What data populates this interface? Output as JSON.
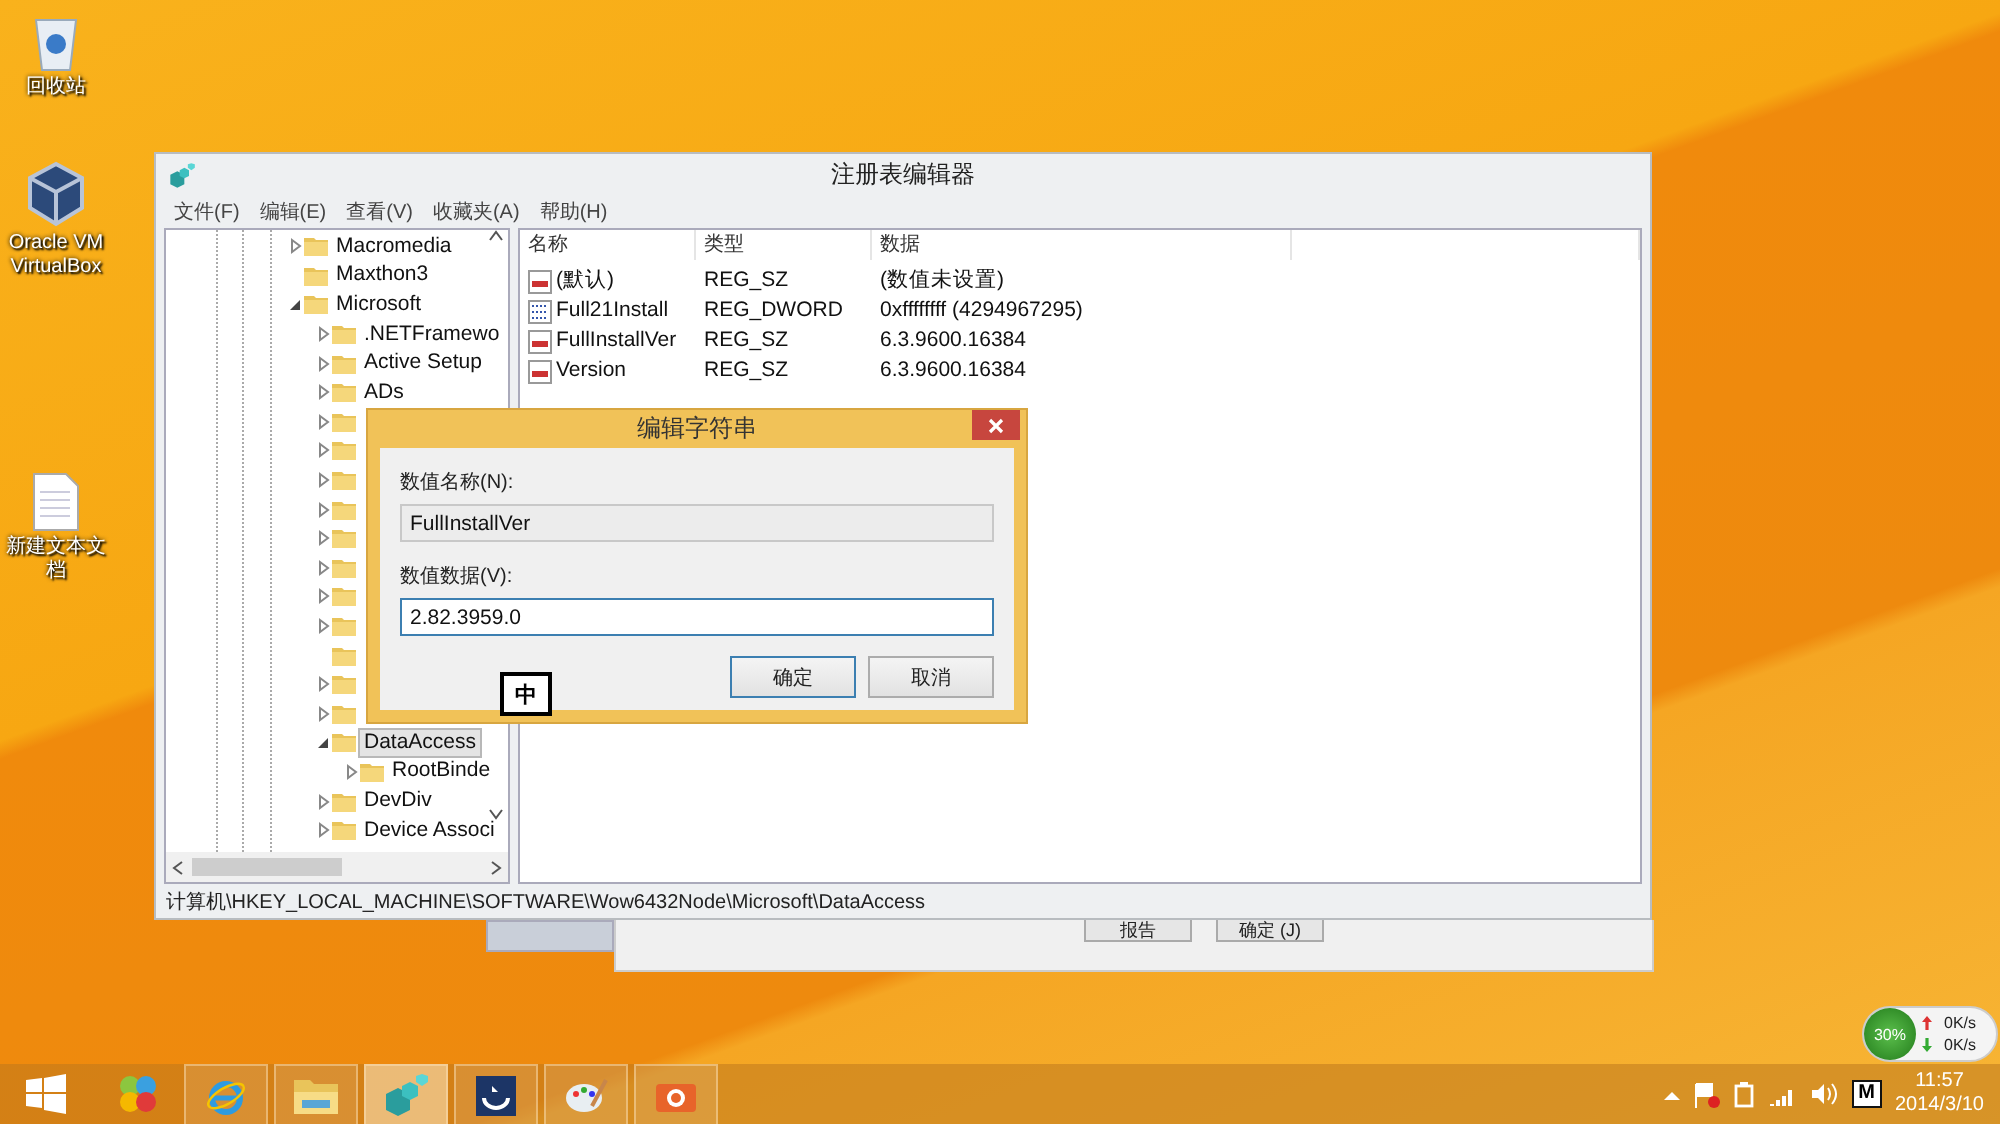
{
  "desktop_icons": [
    {
      "label": "回收站",
      "kind": "recycle"
    },
    {
      "label": "Oracle VM VirtualBox",
      "kind": "virtualbox"
    },
    {
      "label": "新建文本文档",
      "kind": "document"
    }
  ],
  "background_window": {
    "buttons": [
      "报告",
      "确定 (J)"
    ]
  },
  "regedit": {
    "title": "注册表编辑器",
    "menu": [
      "文件(F)",
      "编辑(E)",
      "查看(V)",
      "收藏夹(A)",
      "帮助(H)"
    ],
    "tree": [
      {
        "label": "Macromedia",
        "kind": "collapsed",
        "selected": false
      },
      {
        "label": "Maxthon3",
        "kind": "leaf",
        "selected": false
      },
      {
        "label": "Microsoft",
        "kind": "expanded",
        "selected": false,
        "children": [
          {
            "label": ".NETFramewo",
            "kind": "collapsed",
            "selected": false
          },
          {
            "label": "Active Setup",
            "kind": "collapsed",
            "selected": false
          },
          {
            "label": "ADs",
            "kind": "collapsed",
            "selected": false
          },
          {
            "kind": "collapsed"
          },
          {
            "kind": "collapsed"
          },
          {
            "kind": "collapsed"
          },
          {
            "kind": "collapsed"
          },
          {
            "kind": "collapsed"
          },
          {
            "kind": "collapsed"
          },
          {
            "kind": "collapsed"
          },
          {
            "kind": "collapsed"
          },
          {
            "kind": "leaf"
          },
          {
            "kind": "collapsed"
          },
          {
            "kind": "collapsed"
          },
          {
            "label": "DataAccess",
            "kind": "expanded",
            "selected": true,
            "children": [
              {
                "label": "RootBinde",
                "kind": "collapsed",
                "selected": false
              }
            ]
          },
          {
            "label": "DevDiv",
            "kind": "collapsed",
            "selected": false
          },
          {
            "label": "Device Associ",
            "kind": "collapsed",
            "selected": false
          }
        ]
      }
    ],
    "columns": [
      "名称",
      "类型",
      "数据"
    ],
    "values": [
      {
        "name": "(默认)",
        "type": "REG_SZ",
        "data": "(数值未设置)",
        "kind": "string"
      },
      {
        "name": "Full21Install",
        "type": "REG_DWORD",
        "data": "0xffffffff (4294967295)",
        "kind": "binary"
      },
      {
        "name": "FullInstallVer",
        "type": "REG_SZ",
        "data": "6.3.9600.16384",
        "kind": "string"
      },
      {
        "name": "Version",
        "type": "REG_SZ",
        "data": "6.3.9600.16384",
        "kind": "string"
      }
    ],
    "status_bar": "计算机\\HKEY_LOCAL_MACHINE\\SOFTWARE\\Wow6432Node\\Microsoft\\DataAccess"
  },
  "dialog": {
    "title": "编辑字符串",
    "name_label": "数值名称(N):",
    "name_value": "FullInstallVer",
    "data_label": "数值数据(V):",
    "data_value": "2.82.3959.0",
    "ime_indicator": "中",
    "buttons": [
      {
        "label": "确定",
        "default": true
      },
      {
        "label": "取消",
        "default": false
      }
    ]
  },
  "net_widget": {
    "usage": "30%",
    "up": "0K/s",
    "down": "0K/s"
  },
  "taskbar": {
    "apps": [
      {
        "kind": "start",
        "active": false
      },
      {
        "kind": "colorful",
        "active": false
      },
      {
        "kind": "browser",
        "active": false
      },
      {
        "kind": "folder",
        "active": false
      },
      {
        "kind": "regedit",
        "active": true
      },
      {
        "kind": "blue",
        "active": false
      },
      {
        "kind": "paint",
        "active": false
      },
      {
        "kind": "camera",
        "active": false
      }
    ],
    "ime": "M",
    "time": "11:57",
    "date": "2014/3/10"
  }
}
